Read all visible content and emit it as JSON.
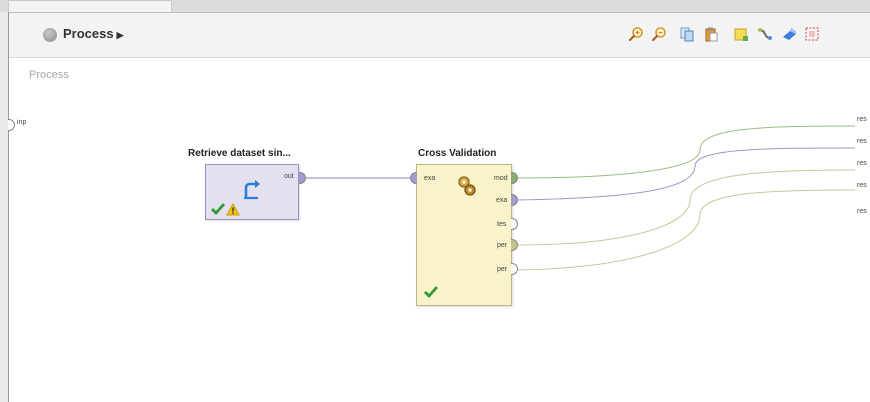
{
  "toolbar": {
    "breadcrumb": "Process",
    "icons": [
      "zoom-in-icon",
      "zoom-out-icon",
      "copy-icon",
      "paste-icon",
      "add-note-icon",
      "auto-wire-icon",
      "layout-icon",
      "fit-view-icon"
    ]
  },
  "canvas": {
    "label": "Process",
    "input_port": "inp",
    "result_ports": [
      "res",
      "res",
      "res",
      "res",
      "res"
    ]
  },
  "operators": {
    "retrieve": {
      "title": "Retrieve dataset sin...",
      "ports": {
        "out": "out"
      }
    },
    "cross_validation": {
      "title": "Cross Validation",
      "in_ports": [
        "exa"
      ],
      "out_ports": [
        "mod",
        "exa",
        "tes",
        "per",
        "per"
      ]
    }
  },
  "colors": {
    "retrieve_fill": "#e4e0ef",
    "cv_fill": "#f8f3c9",
    "model_port": "#8cae6e",
    "example_port": "#a49bd1",
    "performance_port": "#c6c48a",
    "wire_example": "#9f97c7",
    "wire_model": "#9cbb7e",
    "wire_perf": "#c9c69a"
  }
}
